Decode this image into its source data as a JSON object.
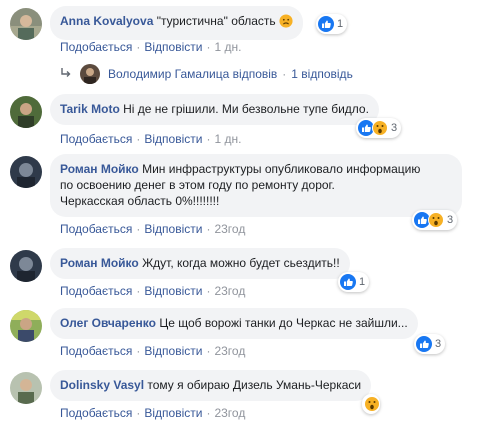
{
  "labels": {
    "like": "Подобається",
    "reply": "Відповісти",
    "dot": "·"
  },
  "comments": [
    {
      "author": "Anna Kovalyova",
      "text": "\"туристична\" область",
      "time": "1 дн.",
      "reaction_count": "1"
    },
    {
      "author": "Tarik Moto",
      "text": "Ні де не грішили. Ми безвольне тупе бидло.",
      "time": "1 дн.",
      "reaction_count": "3"
    },
    {
      "author": "Роман Мойко",
      "lines": [
        "Мин инфраструктуры опубликовало информацию",
        "по освоению денег в этом году по ремонту дорог.",
        "Черкасская область 0%!!!!!!!!"
      ],
      "time": "23год",
      "reaction_count": "3"
    },
    {
      "author": "Роман Мойко",
      "text": "Ждут, когда можно будет сьездить!!",
      "time": "23год",
      "reaction_count": "1"
    },
    {
      "author": "Олег Овчаренко",
      "text": "Це щоб ворожі танки до Черкас не зайшли...",
      "time": "23год",
      "reaction_count": "3"
    },
    {
      "author": "Dolinsky Vasyl",
      "text": "тому я обираю Дизель Умань-Черкаси",
      "time": "23год"
    }
  ],
  "reply_summary": {
    "author": "Володимир Гамалица",
    "verb": "відповів",
    "count": "1 відповідь"
  },
  "colors": {
    "link": "#385898",
    "bubble": "#f2f3f5",
    "like": "#1877f2",
    "wow": "#f7b125"
  },
  "icons": {
    "like": "like-icon",
    "wow": "wow-icon",
    "sad": "sad-icon",
    "reply_arrow": "reply-arrow-icon"
  }
}
